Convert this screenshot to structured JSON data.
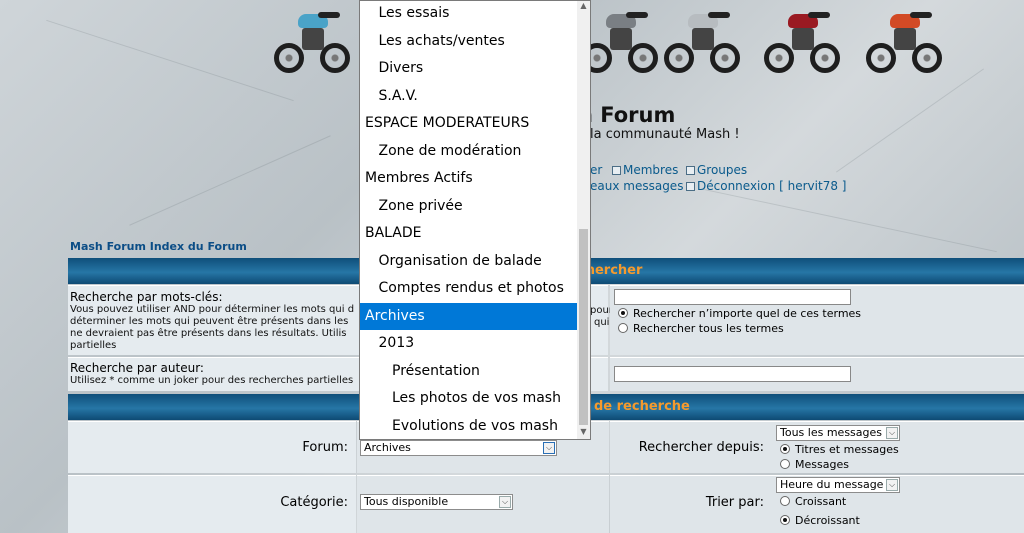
{
  "header": {
    "title": "n Forum",
    "description": "la communauté Mash !",
    "nav": [
      {
        "label": "er",
        "icon": "none"
      },
      {
        "label": "Membres",
        "icon": "members-icon"
      },
      {
        "label": "Groupes",
        "icon": "groups-icon"
      },
      {
        "label": "eaux messages",
        "icon": "none"
      },
      {
        "label": "Déconnexion [ hervit78 ]",
        "icon": "logout-icon"
      }
    ]
  },
  "breadcrumb": "Mash Forum Index du Forum",
  "search": {
    "header": "chercher",
    "keywords_label": "Recherche par mots-clés:",
    "keywords_hint_1": "Vous pouvez utiliser AND pour déterminer les mots qui d",
    "keywords_hint_1b": "pour",
    "keywords_hint_2": "déterminer les mots qui peuvent être présents dans les",
    "keywords_hint_2b": "qui",
    "keywords_hint_3": "ne devraient pas être présents dans les résultats. Utilis",
    "keywords_hint_4": "partielles",
    "radio_any": "Rechercher n’importe quel de ces termes",
    "radio_all": "Rechercher tous les termes",
    "author_label": "Recherche par auteur:",
    "author_hint": "Utilisez * comme un joker pour des recherches partielles"
  },
  "options": {
    "header": "de recherche",
    "forum_label": "Forum:",
    "forum_value": "Archives",
    "since_label": "Rechercher depuis:",
    "since_value": "Tous les messages",
    "radio_titles": "Titres et messages",
    "radio_messages": "Messages",
    "category_label": "Catégorie:",
    "category_value": "Tous disponible",
    "sort_label": "Trier par:",
    "sort_value": "Heure du message",
    "radio_asc": "Croissant",
    "radio_desc": "Décroissant"
  },
  "dropdown": {
    "items": [
      {
        "label": "Les essais",
        "indent": 1
      },
      {
        "label": "Les achats/ventes",
        "indent": 1
      },
      {
        "label": "Divers",
        "indent": 1
      },
      {
        "label": "S.A.V.",
        "indent": 1
      },
      {
        "label": "ESPACE MODERATEURS",
        "indent": 0
      },
      {
        "label": "Zone de modération",
        "indent": 1
      },
      {
        "label": "Membres Actifs",
        "indent": 0
      },
      {
        "label": "Zone privée",
        "indent": 1
      },
      {
        "label": "BALADE",
        "indent": 0
      },
      {
        "label": "Organisation de balade",
        "indent": 1
      },
      {
        "label": "Comptes rendus et photos",
        "indent": 1
      },
      {
        "label": "Archives",
        "indent": 0,
        "selected": true
      },
      {
        "label": "2013",
        "indent": 1
      },
      {
        "label": "Présentation",
        "indent": 2
      },
      {
        "label": "Les photos de vos mash",
        "indent": 2
      },
      {
        "label": "Evolutions de vos mash",
        "indent": 2
      }
    ]
  },
  "colors": {
    "bar_text": "#f59a2d",
    "link": "#0a5a8c",
    "selected": "#0078d7"
  }
}
